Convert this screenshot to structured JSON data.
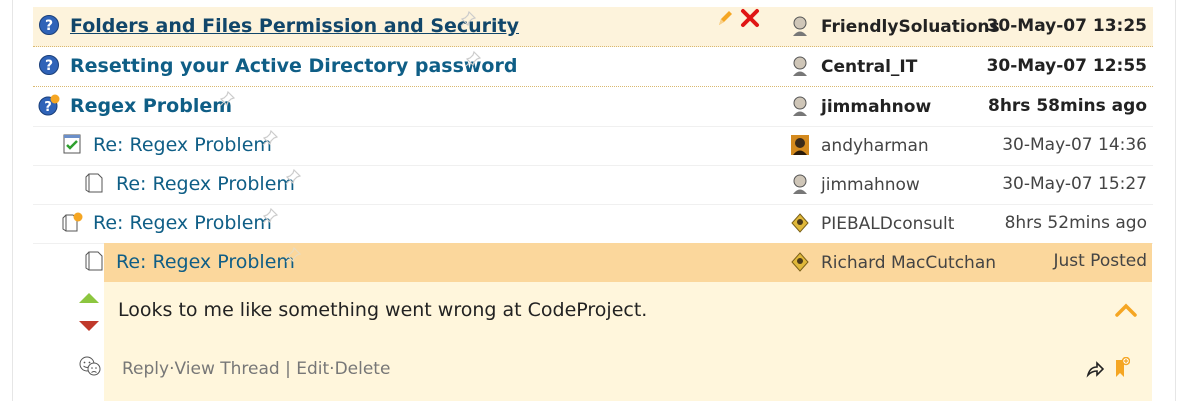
{
  "threads": [
    {
      "title": "Folders and Files Permission and Security",
      "author": "FriendlySoluations",
      "date": "30-May-07 13:25"
    },
    {
      "title": "Resetting your Active Directory password",
      "author": "Central_IT",
      "date": "30-May-07 12:55"
    },
    {
      "title": "Regex Problem",
      "author": "jimmahnow",
      "date": "8hrs 58mins ago"
    },
    {
      "title": "Re: Regex Problem",
      "author": "andyharman",
      "date": "30-May-07 14:36"
    },
    {
      "title": "Re: Regex Problem",
      "author": "jimmahnow",
      "date": "30-May-07 15:27"
    },
    {
      "title": "Re: Regex Problem",
      "author": "PIEBALDconsult",
      "date": "8hrs 52mins ago"
    },
    {
      "title": "Re: Regex Problem",
      "author": "Richard MacCutchan",
      "date": "Just Posted"
    }
  ],
  "message": {
    "body": "Looks to me like something went wrong at CodeProject.",
    "actions": {
      "reply": "Reply",
      "sep1": "·",
      "view_thread": "View Thread",
      "sep2": " | ",
      "edit": "Edit",
      "sep3": "·",
      "delete": "Delete"
    }
  },
  "icons": {
    "question": "question-icon",
    "new_question": "new-question-icon",
    "answer": "answer-icon",
    "page": "page-icon",
    "new_page": "new-page-icon",
    "pin": "pin-icon",
    "edit": "pencil-icon",
    "delete": "delete-x-icon",
    "upvote": "upvote-arrow-icon",
    "downvote": "downvote-arrow-icon",
    "emoji": "emoji-icon",
    "collapse": "chevron-up-icon",
    "share": "share-icon",
    "bookmark": "bookmark-icon"
  },
  "colors": {
    "pinned_bg": "#fdf3dc",
    "selected_bg": "#fbd79c",
    "body_bg": "#fff6dc",
    "link": "#0f5e86",
    "accent": "#f5a623"
  }
}
